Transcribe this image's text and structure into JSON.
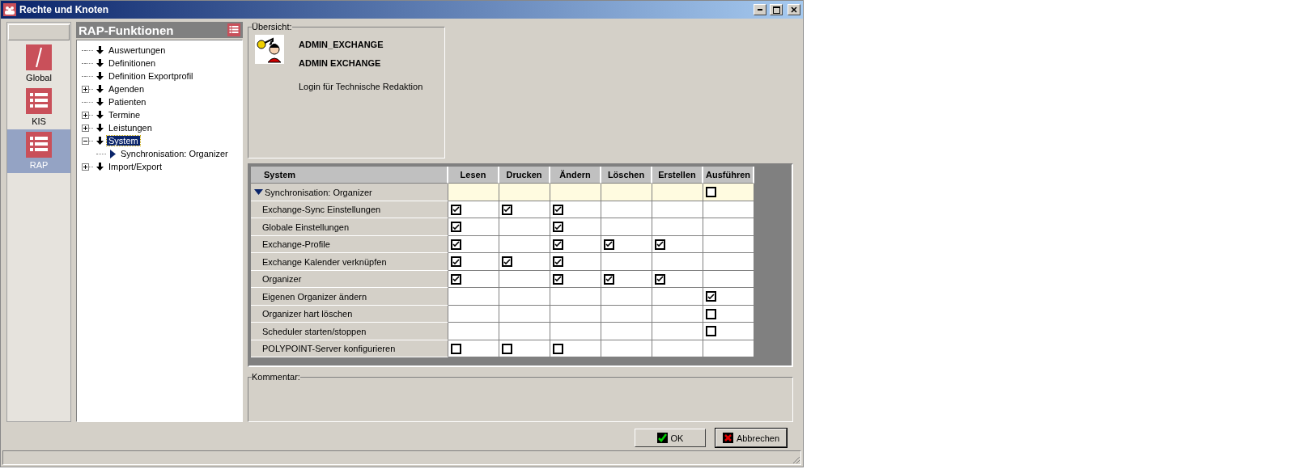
{
  "window": {
    "title": "Rechte und Knoten"
  },
  "nav": {
    "items": [
      {
        "label": "Global",
        "kind": "slash",
        "selected": false
      },
      {
        "label": "KIS",
        "kind": "list",
        "selected": false
      },
      {
        "label": "RAP",
        "kind": "list",
        "selected": true
      }
    ]
  },
  "tree": {
    "title": "RAP-Funktionen",
    "items": [
      {
        "label": "Auswertungen",
        "selected": false
      },
      {
        "label": "Definitionen",
        "selected": false
      },
      {
        "label": "Definition Exportprofil",
        "selected": false
      },
      {
        "label": "Agenden",
        "expanded": false,
        "selected": false
      },
      {
        "label": "Patienten",
        "selected": false
      },
      {
        "label": "Termine",
        "expanded": false,
        "selected": false
      },
      {
        "label": "Leistungen",
        "expanded": false,
        "selected": false
      },
      {
        "label": "System",
        "expanded": true,
        "selected": true,
        "children": [
          {
            "label": "Synchronisation: Organizer",
            "selected": false
          }
        ]
      },
      {
        "label": "Import/Export",
        "expanded": false,
        "selected": false
      }
    ]
  },
  "overview": {
    "legend": "Übersicht:",
    "login": "ADMIN_EXCHANGE",
    "name": "ADMIN EXCHANGE",
    "description": "Login für Technische Redaktion"
  },
  "table": {
    "columns": [
      "System",
      "Lesen",
      "Drucken",
      "Ändern",
      "Löschen",
      "Erstellen",
      "Ausführen"
    ],
    "rows": [
      {
        "kind": "group",
        "label": "Synchronisation: Organizer",
        "expanded": true,
        "cells": [
          null,
          null,
          null,
          null,
          null,
          false
        ]
      },
      {
        "kind": "item",
        "label": "Exchange-Sync Einstellungen",
        "cells": [
          true,
          true,
          true,
          null,
          null,
          null
        ]
      },
      {
        "kind": "item",
        "label": "Globale Einstellungen",
        "cells": [
          true,
          null,
          true,
          null,
          null,
          null
        ]
      },
      {
        "kind": "item",
        "label": "Exchange-Profile",
        "cells": [
          true,
          null,
          true,
          true,
          true,
          null
        ]
      },
      {
        "kind": "item",
        "label": "Exchange Kalender verknüpfen",
        "cells": [
          true,
          true,
          true,
          null,
          null,
          null
        ]
      },
      {
        "kind": "item",
        "label": "Organizer",
        "cells": [
          true,
          null,
          true,
          true,
          true,
          null
        ]
      },
      {
        "kind": "item",
        "label": "Eigenen Organizer ändern",
        "cells": [
          null,
          null,
          null,
          null,
          null,
          true
        ]
      },
      {
        "kind": "item",
        "label": "Organizer hart löschen",
        "cells": [
          null,
          null,
          null,
          null,
          null,
          false
        ]
      },
      {
        "kind": "item",
        "label": "Scheduler starten/stoppen",
        "cells": [
          null,
          null,
          null,
          null,
          null,
          false
        ]
      },
      {
        "kind": "item",
        "label": "POLYPOINT-Server konfigurieren",
        "cells": [
          false,
          false,
          false,
          null,
          null,
          null
        ]
      }
    ]
  },
  "comment": {
    "legend": "Kommentar:"
  },
  "buttons": [
    {
      "label": "OK",
      "kind": "ok"
    },
    {
      "label": "Abbrechen",
      "kind": "cancel"
    }
  ]
}
